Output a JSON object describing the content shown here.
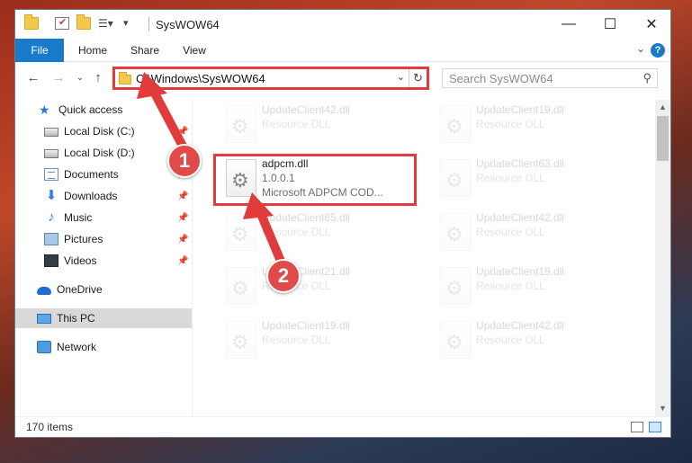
{
  "window": {
    "title": "SysWOW64",
    "controls": {
      "minimize": "—",
      "maximize": "☐",
      "close": "✕"
    }
  },
  "ribbon": {
    "tabs": [
      "File",
      "Home",
      "Share",
      "View"
    ],
    "help": "?"
  },
  "navigation": {
    "address": "C:\\Windows\\SysWOW64",
    "search_placeholder": "Search SysWOW64"
  },
  "sidebar": {
    "items": [
      {
        "label": "Quick access",
        "icon": "star-icon"
      },
      {
        "label": "Local Disk (C:)",
        "icon": "drive-icon"
      },
      {
        "label": "Local Disk (D:)",
        "icon": "drive-icon"
      },
      {
        "label": "Documents",
        "icon": "documents-icon"
      },
      {
        "label": "Downloads",
        "icon": "downloads-icon"
      },
      {
        "label": "Music",
        "icon": "music-icon"
      },
      {
        "label": "Pictures",
        "icon": "pictures-icon"
      },
      {
        "label": "Videos",
        "icon": "videos-icon"
      },
      {
        "label": "OneDrive",
        "icon": "cloud-icon"
      },
      {
        "label": "This PC",
        "icon": "computer-icon"
      },
      {
        "label": "Network",
        "icon": "network-icon"
      }
    ]
  },
  "files": [
    {
      "name": "UpdateClient42.dll",
      "type": "Resource DLL"
    },
    {
      "name": "UpdateClient19.dll",
      "type": "Resource DLL"
    },
    {
      "name": "adpcm.dll",
      "version": "1.0.0.1",
      "description": "Microsoft ADPCM COD..."
    },
    {
      "name": "UpdateClient63.dll",
      "type": "Resource DLL"
    },
    {
      "name": "UpdateClient65.dll",
      "type": "Resource DLL"
    },
    {
      "name": "UpdateClient42.dll",
      "type": "Resource DLL"
    },
    {
      "name": "UpdateClient21.dll",
      "type": "Resource DLL"
    },
    {
      "name": "UpdateClient19.dll",
      "type": "Resource DLL"
    },
    {
      "name": "UpdateClient19.dll",
      "type": "Resource DLL"
    },
    {
      "name": "UpdateClient42.dll",
      "type": "Resource DLL"
    }
  ],
  "status": {
    "item_count": "170 items"
  },
  "annotations": {
    "step1": "1",
    "step2": "2",
    "accent_color": "#e03c3c"
  }
}
